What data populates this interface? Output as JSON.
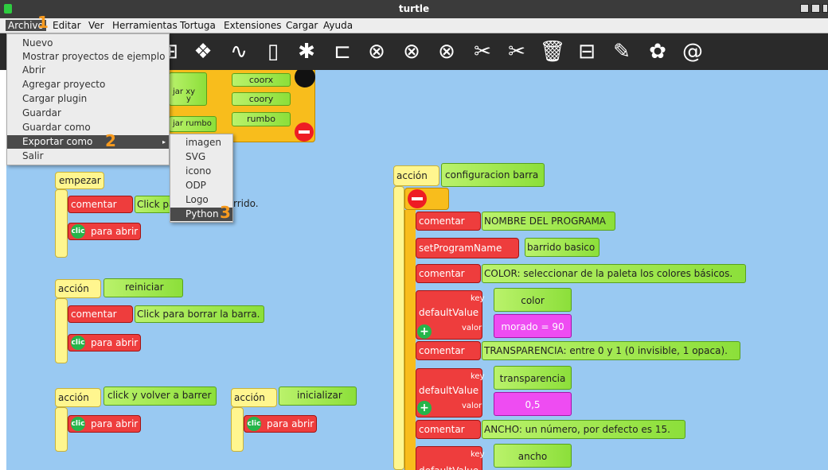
{
  "window": {
    "title": "turtle"
  },
  "menubar": [
    "Archivo",
    "Editar",
    "Ver",
    "Herramientas",
    "Tortuga",
    "Extensiones",
    "Cargar",
    "Ayuda"
  ],
  "file_menu": [
    "Nuevo",
    "Mostrar proyectos de ejemplo",
    "Abrir",
    "Agregar proyecto",
    "Cargar plugin",
    "Guardar",
    "Guardar como",
    "Exportar como",
    "Salir"
  ],
  "export_submenu": [
    "imagen",
    "SVG",
    "icono",
    "ODP",
    "Logo",
    "Python"
  ],
  "annotations": {
    "one": "1",
    "two": "2",
    "three": "3"
  },
  "top_blocks": {
    "fijar_xy": "jar xy",
    "y": "y",
    "coorx": "coorx",
    "coory": "coory",
    "fijar_rumbo": "jar rumbo",
    "rumbo": "rumbo"
  },
  "left_stacks": {
    "empezar": "empezar",
    "comentar": "comentar",
    "clic_text": "Click pa",
    "clic_tail": "rrido.",
    "clic_para_abrir": "para abrir",
    "clic_badge": "clic",
    "accion": "acción",
    "reiniciar": "reiniciar",
    "borrar": "Click para borrar la barra.",
    "volver": "click y volver a barrer",
    "inicializar": "inicializar"
  },
  "right_stack": {
    "accion": "acción",
    "title": "configuracion barra",
    "comentar": "comentar",
    "set_program": "setProgramName",
    "key": "key",
    "valor": "valor",
    "default_value": "defaultValue",
    "default_value_cut": "defaultValue",
    "lines": [
      "NOMBRE DEL PROGRAMA",
      "barrido basico",
      "COLOR: seleccionar de la paleta los colores básicos.",
      "color",
      "morado = 90",
      "TRANSPARENCIA: entre 0 y 1 (0 invisible, 1 opaca).",
      "transparencia",
      "0,5",
      "ANCHO: un número, por defecto es 15.",
      "ancho"
    ]
  },
  "colors": {
    "canvas": "#99c9f2",
    "toolbar": "#2a2a2a",
    "block_red": "#ee3d3d",
    "block_green": "#8cdf3a",
    "block_yellow": "#fff68f",
    "block_magenta": "#ee4cf2",
    "annotation": "#f79a1e"
  }
}
